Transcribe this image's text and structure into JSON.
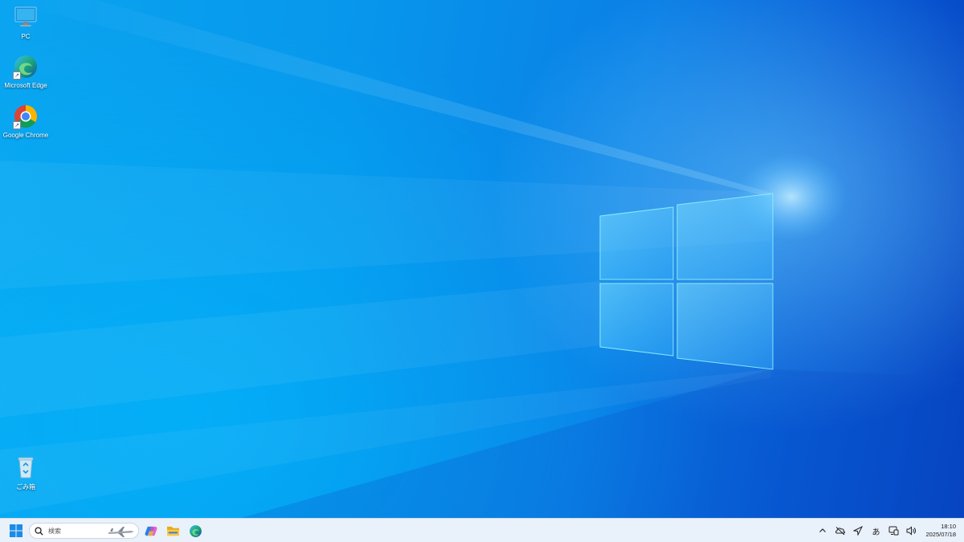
{
  "desktop": {
    "icons": [
      {
        "label": "PC",
        "icon": "pc-monitor-icon"
      },
      {
        "label": "Microsoft Edge",
        "icon": "edge-icon"
      },
      {
        "label": "Google Chrome",
        "icon": "chrome-icon"
      },
      {
        "label": "ごみ箱",
        "icon": "recycle-bin-icon"
      }
    ]
  },
  "taskbar": {
    "start_icon": "windows-start-icon",
    "search": {
      "placeholder": "検索",
      "icon": "search-icon",
      "highlight_icon": "search-highlight-airplane-icon"
    },
    "pinned": [
      {
        "name": "Copilot",
        "icon": "copilot-icon"
      },
      {
        "name": "File Explorer",
        "icon": "folder-icon"
      },
      {
        "name": "Microsoft Edge",
        "icon": "edge-icon"
      }
    ],
    "tray": {
      "icons": [
        "chevron-up-icon",
        "onedrive-offline-icon",
        "location-icon",
        "ime-icon",
        "network-icon",
        "volume-icon"
      ],
      "ime_label": "あ",
      "time": "18:10",
      "date": "2025/07/18"
    }
  },
  "colors": {
    "wallpaper_light": "#0aa5f0",
    "wallpaper_dark": "#0640bf",
    "taskbar_bg": "#e9f1fa"
  }
}
